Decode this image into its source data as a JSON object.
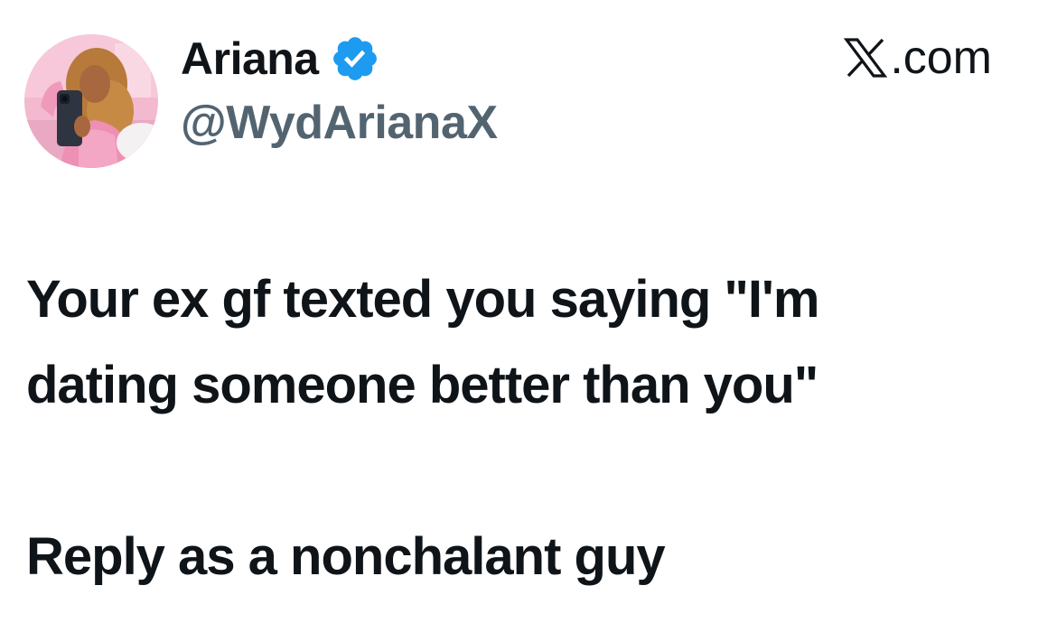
{
  "author": {
    "display_name": "Ariana",
    "handle": "@WydArianaX",
    "verified_icon": "verified-badge-icon",
    "avatar_icon": "profile-avatar"
  },
  "site": {
    "label": ".com",
    "logo_icon": "x-logo-icon"
  },
  "tweet": {
    "line1": "Your ex gf texted you saying \"I'm",
    "line2": "dating someone better than you\"",
    "line3": "Reply as a nonchalant guy"
  },
  "colors": {
    "text_primary": "#0f1419",
    "text_secondary": "#536471",
    "verified_blue": "#1d9bf0",
    "background": "#ffffff"
  }
}
